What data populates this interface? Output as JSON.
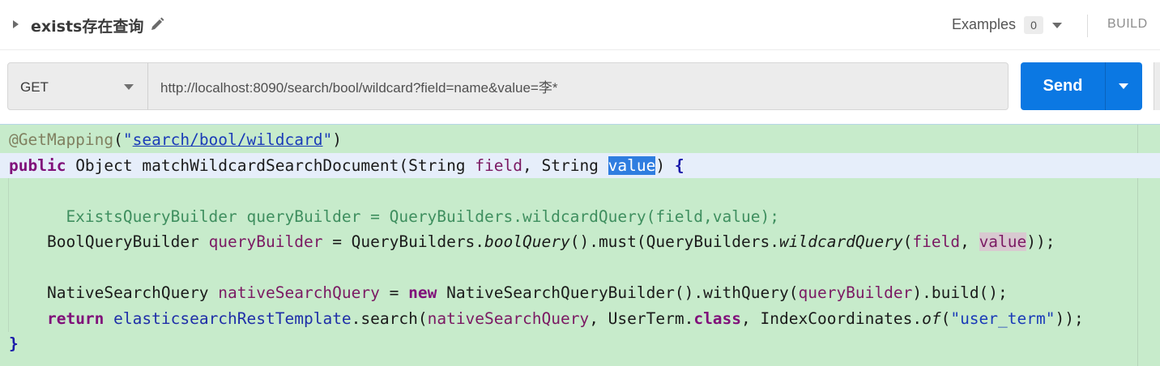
{
  "header": {
    "request_title": "exists存在查询",
    "examples_label": "Examples",
    "examples_count": "0",
    "build_label": "BUILD"
  },
  "request": {
    "method": "GET",
    "url": "http://localhost:8090/search/bool/wildcard?field=name&value=李*",
    "send_label": "Send"
  },
  "code": {
    "line1_annotation": "@GetMapping",
    "line1_open": "(",
    "line1_quote_open": "\"",
    "line1_path": "search/bool/wildcard",
    "line1_quote_close": "\"",
    "line1_close": ")",
    "line2_kw_public": "public",
    "line2_type": " Object ",
    "line2_method": "matchWildcardSearchDocument",
    "line2_paren": "(",
    "line2_string1": "String ",
    "line2_field": "field",
    "line2_comma": ", ",
    "line2_string2": "String ",
    "line2_value": "value",
    "line2_close": ") ",
    "line2_brace": "{",
    "line4_comment": "      ExistsQueryBuilder queryBuilder = QueryBuilders.wildcardQuery(field,value);",
    "line5_indent": "    ",
    "line5_type": "BoolQueryBuilder ",
    "line5_var": "queryBuilder",
    "line5_eq": " = QueryBuilders.",
    "line5_bool": "boolQuery",
    "line5_must": "().must(QueryBuilders.",
    "line5_wild": "wildcardQuery",
    "line5_open": "(",
    "line5_field": "field",
    "line5_comma": ", ",
    "line5_value": "value",
    "line5_close": "));",
    "line7_indent": "    ",
    "line7_type": "NativeSearchQuery ",
    "line7_var": "nativeSearchQuery",
    "line7_eq": " = ",
    "line7_new": "new",
    "line7_builder": " NativeSearchQueryBuilder().withQuery(",
    "line7_qb": "queryBuilder",
    "line7_build": ").build();",
    "line8_indent": "    ",
    "line8_return": "return",
    "line8_sp": " ",
    "line8_template": "elasticsearchRestTemplate",
    "line8_search": ".search(",
    "line8_nsq": "nativeSearchQuery",
    "line8_userterm": ", UserTerm.",
    "line8_class": "class",
    "line8_ic": ", IndexCoordinates.",
    "line8_of": "of",
    "line8_open": "(",
    "line8_str": "\"user_term\"",
    "line8_close": "));",
    "line9_brace": "}"
  },
  "icons": {
    "collapse": "caret-right-icon",
    "edit": "pencil-icon",
    "examples_dropdown": "caret-down-icon",
    "method_dropdown": "caret-down-icon",
    "send_dropdown": "caret-down-icon"
  },
  "colors": {
    "send_button": "#0b78e3",
    "code_background": "#c7ebcb",
    "current_line": "#e6eefa",
    "selection": "#2f7de0"
  }
}
